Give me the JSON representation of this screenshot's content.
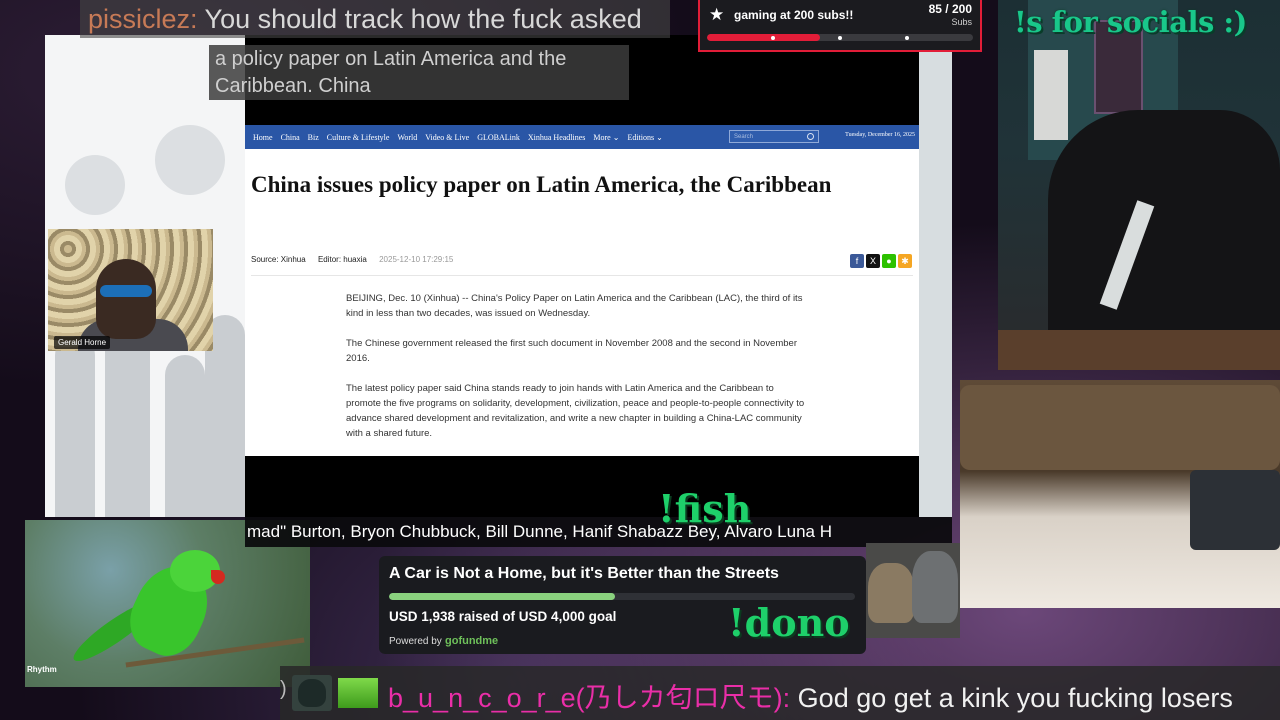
{
  "chat_top": {
    "username": "pissiclez:",
    "message": "You should track how the fuck asked"
  },
  "subs_goal": {
    "title": "gaming at 200 subs!!",
    "count": "85 / 200",
    "unit": "Subs",
    "progress": 0.425,
    "accent_color": "#e21d38"
  },
  "socials_command": "!s for socials :)",
  "caption": "a policy paper on Latin America and the Caribbean. China",
  "site_nav": {
    "items": [
      "Home",
      "China",
      "Biz",
      "Culture & Lifestyle",
      "World",
      "Video & Live",
      "GLOBALink",
      "Xinhua Headlines",
      "More ⌄",
      "Editions ⌄"
    ],
    "search_placeholder": "Search",
    "date": "Tuesday, December 16, 2025"
  },
  "article": {
    "headline": "China issues policy paper on Latin America, the Caribbean",
    "source": "Source: Xinhua",
    "editor": "Editor: huaxia",
    "timestamp": "2025-12-10 17:29:15",
    "share_icons": [
      "facebook-icon",
      "x-icon",
      "wechat-icon",
      "weibo-icon"
    ],
    "paragraphs": [
      "BEIJING, Dec. 10 (Xinhua) -- China's Policy Paper on Latin America and the Caribbean (LAC), the third of its kind in less than two decades, was issued on Wednesday.",
      "The Chinese government released the first such document in November 2008 and the second in November 2016.",
      "The latest policy paper said China stands ready to join hands with Latin America and the Caribbean to promote the five programs on solidarity, development, civilization, peace and people-to-people connectivity to advance shared development and revitalization, and write a new chapter in building a China-LAC community with a shared future."
    ]
  },
  "video_tile": {
    "name": "Gerald Horne"
  },
  "ticker": "mad\" Burton, Bryon Chubbuck, Bill Dunne, Hanif Shabazz Bey, Alvaro Luna H",
  "fish_command": "!fish",
  "fundraiser": {
    "title": "A Car is Not a Home, but it's Better than the Streets",
    "raised": "USD 1,938 raised of USD 4,000 goal",
    "progress": 0.4845,
    "powered_by": "Powered by",
    "logo": "gofundme",
    "accent_color": "#8ad27e"
  },
  "dono_command": "!dono",
  "parrot_logo": "Rhythm",
  "chat_bottom": {
    "prefix": ")",
    "username": "b_u_n_c_o_r_e(乃しカ匂ロ尺モ):",
    "message": "God go get a kink you fucking losers"
  }
}
